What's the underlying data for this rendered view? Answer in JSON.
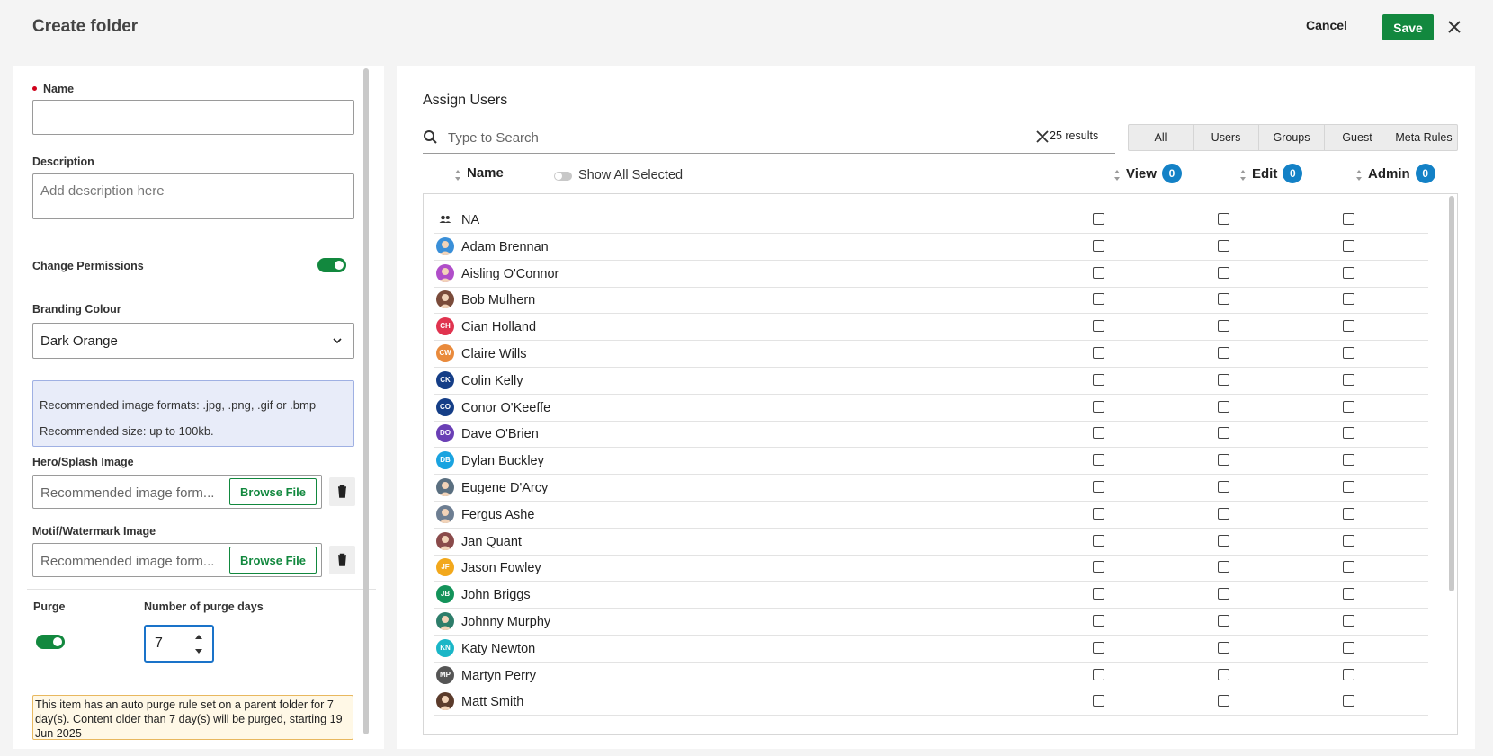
{
  "header": {
    "title": "Create folder",
    "cancel_label": "Cancel",
    "save_label": "Save"
  },
  "form": {
    "name_label": "Name",
    "name_value": "",
    "description_label": "Description",
    "description_placeholder": "Add description here",
    "change_permissions_label": "Change Permissions",
    "change_permissions_on": true,
    "branding_label": "Branding Colour",
    "branding_value": "Dark Orange",
    "info_formats": "Recommended image formats: .jpg, .png, .gif or .bmp",
    "info_size": "Recommended size: up to 100kb.",
    "hero_label": "Hero/Splash Image",
    "hero_placeholder": "Recommended image form...",
    "motif_label": "Motif/Watermark Image",
    "motif_placeholder": "Recommended image form...",
    "browse_label": "Browse File",
    "purge_label": "Purge",
    "purge_on": true,
    "purge_days_label": "Number of purge days",
    "purge_days_value": "7",
    "purge_warning": "This item has an auto purge rule set on a parent folder for 7 day(s). Content older than 7 day(s) will be purged, starting 19 Jun 2025"
  },
  "assign": {
    "title": "Assign Users",
    "search_placeholder": "Type to Search",
    "results": "25 results",
    "filters": [
      "All",
      "Users",
      "Groups",
      "Guest",
      "Meta Rules"
    ],
    "columns": {
      "name": "Name",
      "view": "View",
      "edit": "Edit",
      "admin": "Admin"
    },
    "counts": {
      "view": "0",
      "edit": "0",
      "admin": "0"
    },
    "show_all_selected": "Show All Selected",
    "rows": [
      {
        "name": "NA",
        "avatar": "group-icon",
        "color": ""
      },
      {
        "name": "Adam Brennan",
        "avatar": "photo",
        "color": "#3a8fd8"
      },
      {
        "name": "Aisling O'Connor",
        "avatar": "photo",
        "color": "#b04ec9"
      },
      {
        "name": "Bob Mulhern",
        "avatar": "photo",
        "color": "#7a4b3a"
      },
      {
        "name": "Cian Holland",
        "avatar": "CH",
        "color": "#e0334f"
      },
      {
        "name": "Claire Wills",
        "avatar": "CW",
        "color": "#e98a3c"
      },
      {
        "name": "Colin Kelly",
        "avatar": "CK",
        "color": "#153e87"
      },
      {
        "name": "Conor O'Keeffe",
        "avatar": "CO",
        "color": "#153e87"
      },
      {
        "name": "Dave O'Brien",
        "avatar": "DO",
        "color": "#6a3fb5"
      },
      {
        "name": "Dylan Buckley",
        "avatar": "DB",
        "color": "#1aa3e0"
      },
      {
        "name": "Eugene D'Arcy",
        "avatar": "photo",
        "color": "#5a6f80"
      },
      {
        "name": "Fergus Ashe",
        "avatar": "photo",
        "color": "#6d7e92"
      },
      {
        "name": "Jan Quant",
        "avatar": "photo",
        "color": "#8a4a4a"
      },
      {
        "name": "Jason Fowley",
        "avatar": "JF",
        "color": "#f2a81c"
      },
      {
        "name": "John Briggs",
        "avatar": "JB",
        "color": "#13935a"
      },
      {
        "name": "Johnny Murphy",
        "avatar": "photo",
        "color": "#2d7d6a"
      },
      {
        "name": "Katy Newton",
        "avatar": "KN",
        "color": "#1ab6c7"
      },
      {
        "name": "Martyn Perry",
        "avatar": "MP",
        "color": "#555555"
      },
      {
        "name": "Matt Smith",
        "avatar": "photo",
        "color": "#5b3b2b"
      }
    ]
  },
  "colors": {
    "accent_green": "#12883e",
    "badge_blue": "#1381c6",
    "focus_blue": "#1a73c9"
  }
}
